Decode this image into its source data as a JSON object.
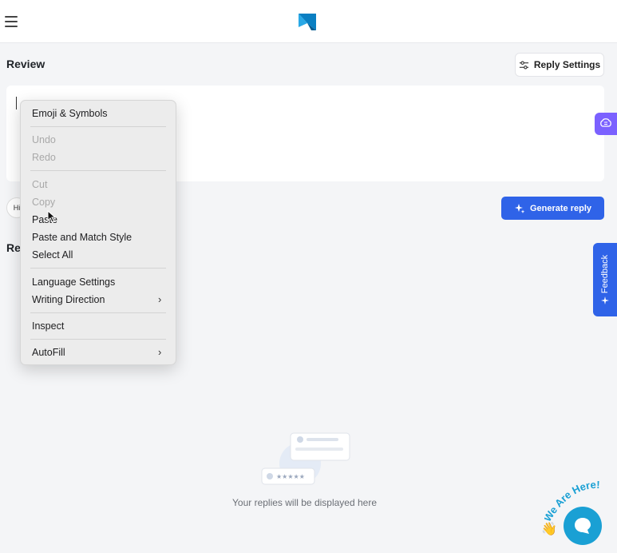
{
  "header": {
    "logo_icon": "app-logo-icon",
    "menu_icon": "hamburger-icon"
  },
  "review": {
    "title": "Review"
  },
  "reply_settings": {
    "label": "Reply Settings",
    "icon": "sliders-icon"
  },
  "chip": {
    "label": "Hi"
  },
  "replies": {
    "title_fragment": "Re",
    "empty_text": "Your replies will be displayed here"
  },
  "generate": {
    "label": "Generate reply",
    "icon": "sparkle-icon"
  },
  "feedback": {
    "label": "Feedback"
  },
  "chat": {
    "badge": "We Are Here!"
  },
  "context_menu": {
    "items": [
      {
        "label": "Emoji & Symbols",
        "enabled": true
      },
      {
        "label": "Undo",
        "enabled": false
      },
      {
        "label": "Redo",
        "enabled": false
      },
      {
        "label": "Cut",
        "enabled": false
      },
      {
        "label": "Copy",
        "enabled": false
      },
      {
        "label": "Paste",
        "enabled": true
      },
      {
        "label": "Paste and Match Style",
        "enabled": true
      },
      {
        "label": "Select All",
        "enabled": true
      },
      {
        "label": "Language Settings",
        "enabled": true
      },
      {
        "label": "Writing Direction",
        "enabled": true,
        "submenu": true
      },
      {
        "label": "Inspect",
        "enabled": true
      },
      {
        "label": "AutoFill",
        "enabled": true,
        "submenu": true
      }
    ]
  },
  "colors": {
    "accent": "#2f63e8",
    "purple": "#7b61ff",
    "chat": "#1aa0d4",
    "menu_bg": "#ececec"
  }
}
